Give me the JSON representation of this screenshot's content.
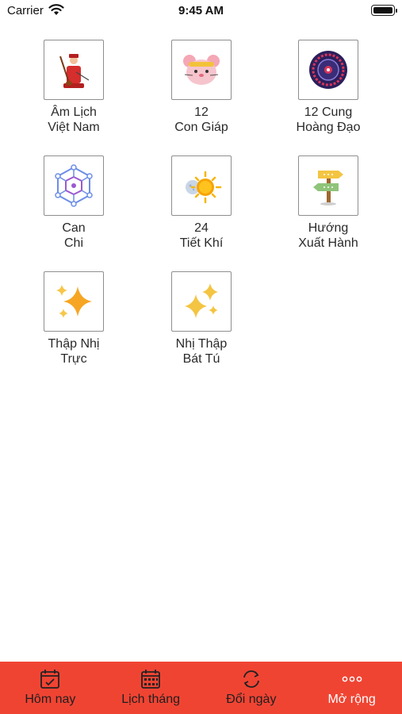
{
  "status_bar": {
    "carrier": "Carrier",
    "time": "9:45 AM"
  },
  "menu_items": [
    {
      "line1": "Âm Lịch",
      "line2": "Việt Nam",
      "icon": "musician-icon"
    },
    {
      "line1": "12",
      "line2": "Con Giáp",
      "icon": "zodiac-rat-icon"
    },
    {
      "line1": "12 Cung",
      "line2": "Hoàng Đạo",
      "icon": "zodiac-wheel-icon"
    },
    {
      "line1": "Can",
      "line2": "Chi",
      "icon": "hexagon-network-icon"
    },
    {
      "line1": "24",
      "line2": "Tiết Khí",
      "icon": "sun-moon-icon"
    },
    {
      "line1": "Hướng",
      "line2": "Xuất Hành",
      "icon": "signpost-icon"
    },
    {
      "line1": "Thập Nhị",
      "line2": "Trực",
      "icon": "sparkle-icon"
    },
    {
      "line1": "Nhị Thập",
      "line2": "Bát Tú",
      "icon": "stars-icon"
    }
  ],
  "tab_bar": {
    "tabs": [
      {
        "label": "Hôm nay",
        "icon": "today-calendar-icon"
      },
      {
        "label": "Lịch tháng",
        "icon": "month-calendar-icon"
      },
      {
        "label": "Đổi ngày",
        "icon": "convert-date-icon"
      },
      {
        "label": "Mở rộng",
        "icon": "more-icon"
      }
    ],
    "active_index": 3,
    "background": "#f04433"
  }
}
